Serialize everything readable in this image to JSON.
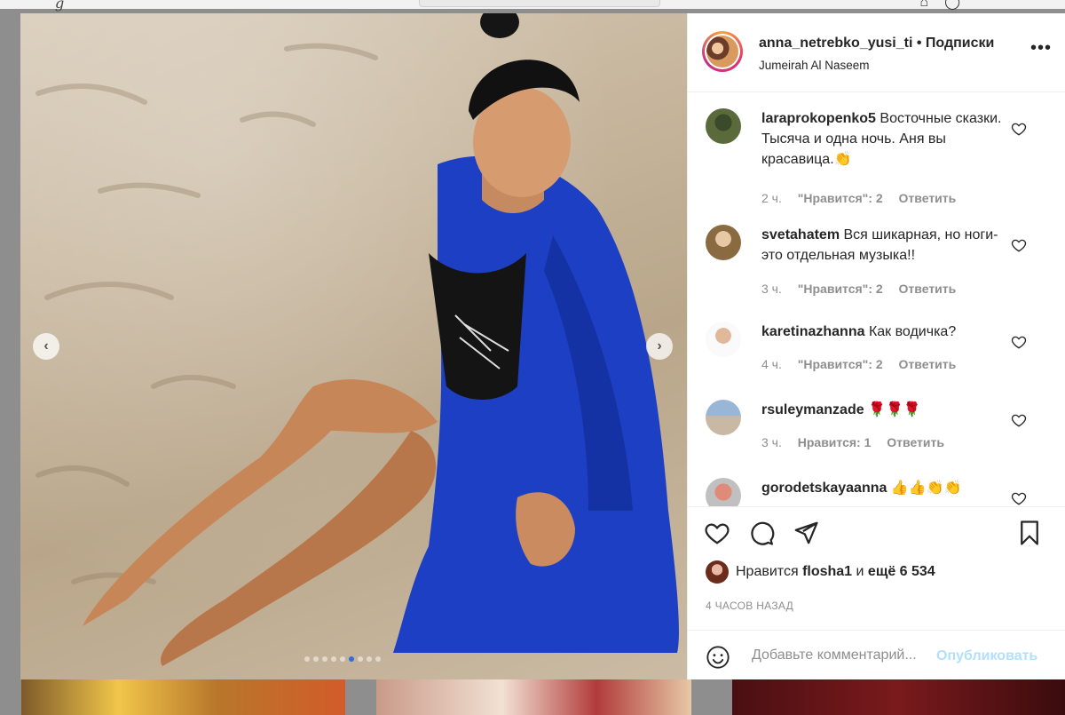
{
  "post": {
    "username": "anna_netrebko_yusi_ti",
    "separator": "•",
    "follow_label": "Подписки",
    "location": "Jumeirah Al Naseem",
    "more_icon": "more-options-icon"
  },
  "carousel": {
    "prev_icon": "chevron-left-icon",
    "next_icon": "chevron-right-icon",
    "slide_count": 9,
    "active_slide": 6
  },
  "comments": [
    {
      "username": "laraprokopenko5",
      "text": "Восточные сказки. Тысяча и одна ночь. Аня вы красавица.👏",
      "time": "2 ч.",
      "likes": "\"Нравится\": 2",
      "reply": "Ответить"
    },
    {
      "username": "svetahatem",
      "text": "Вся шикарная, но ноги- это отдельная музыка!!",
      "time": "3 ч.",
      "likes": "\"Нравится\": 2",
      "reply": "Ответить"
    },
    {
      "username": "karetinazhanna",
      "text": "Как водичка?",
      "time": "4 ч.",
      "likes": "\"Нравится\": 2",
      "reply": "Ответить"
    },
    {
      "username": "rsuleymanzade",
      "text": "🌹🌹🌹",
      "time": "3 ч.",
      "likes": "Нравится: 1",
      "reply": "Ответить"
    },
    {
      "username": "gorodetskayaanna",
      "text": "👍👍👏👏",
      "time": "",
      "likes": "",
      "reply": ""
    }
  ],
  "actions": {
    "like_icon": "heart-icon",
    "comment_icon": "comment-icon",
    "share_icon": "share-icon",
    "save_icon": "bookmark-icon"
  },
  "likes": {
    "prefix": "Нравится",
    "user": "flosha1",
    "and": "и",
    "more": "ещё 6 534"
  },
  "timestamp": "4 ЧАСОВ НАЗАД",
  "add_comment": {
    "placeholder": "Добавьте комментарий...",
    "publish_label": "Опубликовать"
  },
  "colors": {
    "text": "#262626",
    "muted": "#8e8e8e",
    "publish_disabled": "#b2dffc",
    "carousel_active_dot": "#2f6fdb"
  }
}
